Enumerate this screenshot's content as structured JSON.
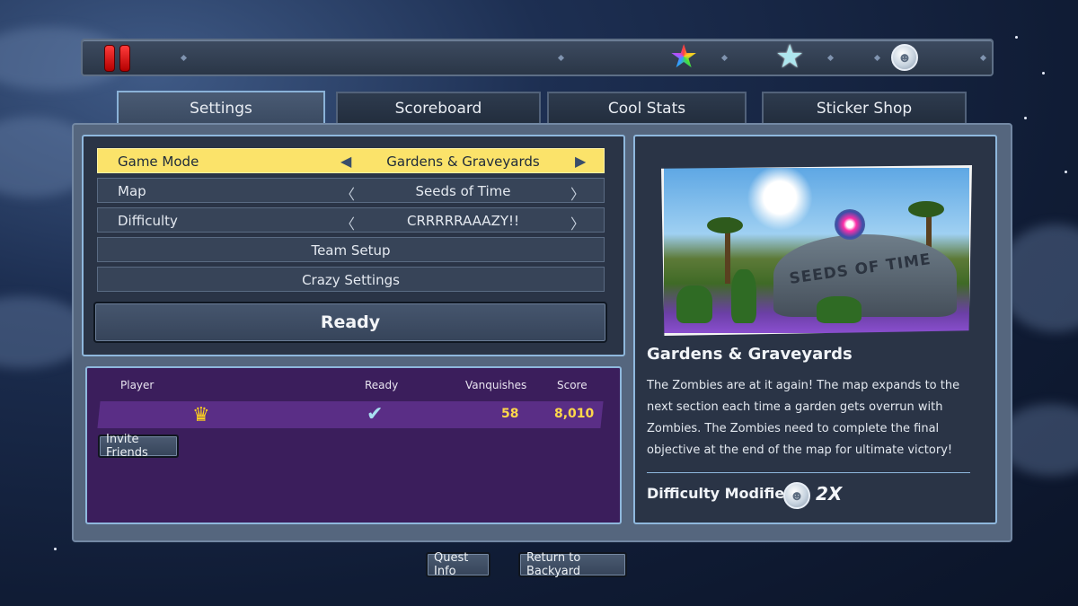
{
  "tabs": [
    {
      "label": "Settings",
      "active": true
    },
    {
      "label": "Scoreboard",
      "active": false
    },
    {
      "label": "Cool Stats",
      "active": false
    },
    {
      "label": "Sticker Shop",
      "active": false
    }
  ],
  "topbar": {
    "icons": [
      "pause-icon",
      "rainbow-star-icon",
      "star-icon",
      "zombie-coin-icon"
    ]
  },
  "settings": {
    "rows": [
      {
        "label": "Game Mode",
        "value": "Gardens & Graveyards",
        "selected": true
      },
      {
        "label": "Map",
        "value": "Seeds of Time"
      },
      {
        "label": "Difficulty",
        "value": "CRRRRRAAAZY!!"
      }
    ],
    "team_setup": "Team Setup",
    "crazy_settings": "Crazy Settings",
    "ready": "Ready"
  },
  "players": {
    "headers": {
      "player": "Player",
      "ready": "Ready",
      "vanquishes": "Vanquishes",
      "score": "Score"
    },
    "rows": [
      {
        "vanquishes": "58",
        "score": "8,010",
        "icon": "crown-icon",
        "ready_icon": "check-icon"
      }
    ],
    "invite": "Invite Friends"
  },
  "info": {
    "map_sign": "SEEDS OF TIME",
    "title": "Gardens & Graveyards",
    "description": "The Zombies are at it again! The map expands to the next section each time a garden gets overrun with Zombies. The Zombies need to complete the final objective at the end of the map for ultimate victory!",
    "difficulty_label": "Difficulty Modifier",
    "multiplier": "2X"
  },
  "footer": {
    "quest_info": "Quest Info",
    "return": "Return to Backyard"
  },
  "colors": {
    "selected_row": "#fbe36a",
    "panel_border": "#8fb8dd",
    "player_panel": "#3b1e5c",
    "score_text": "#ffd84a"
  }
}
